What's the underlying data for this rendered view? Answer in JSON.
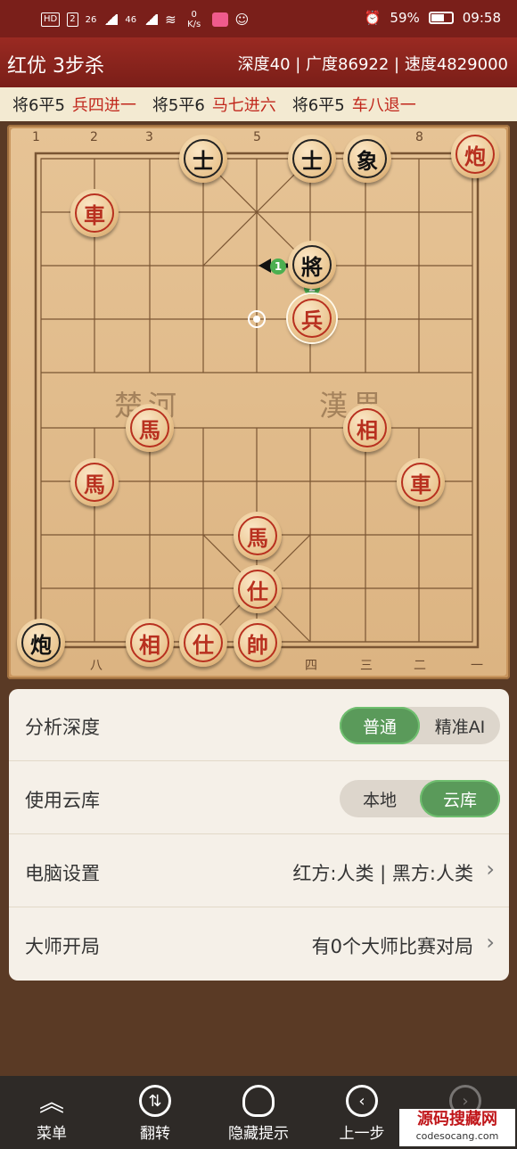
{
  "status": {
    "badges": [
      "HD",
      "2",
      "26",
      "46"
    ],
    "speed": "0 K/s",
    "battery": "59%",
    "time": "09:58"
  },
  "title": {
    "text": "红优 3步杀",
    "stats": "深度40 | 广度86922 | 速度4829000"
  },
  "moves": [
    {
      "black": "将6平5",
      "red": "兵四进一"
    },
    {
      "black": "将5平6",
      "red": "马七进六"
    },
    {
      "black": "将6平5",
      "red": "车八退一"
    }
  ],
  "board": {
    "top_files": [
      "1",
      "2",
      "3",
      "5",
      "8"
    ],
    "bottom_files": [
      "八",
      "四",
      "三",
      "二",
      "一"
    ],
    "river_left": "楚河",
    "river_right": "漢界",
    "markers": [
      "1",
      "2"
    ],
    "pieces": [
      {
        "ch": "士",
        "side": "black"
      },
      {
        "ch": "士",
        "side": "black"
      },
      {
        "ch": "象",
        "side": "black"
      },
      {
        "ch": "炮",
        "side": "red"
      },
      {
        "ch": "車",
        "side": "red"
      },
      {
        "ch": "將",
        "side": "black"
      },
      {
        "ch": "兵",
        "side": "red"
      },
      {
        "ch": "馬",
        "side": "red"
      },
      {
        "ch": "相",
        "side": "red"
      },
      {
        "ch": "馬",
        "side": "red"
      },
      {
        "ch": "車",
        "side": "red"
      },
      {
        "ch": "馬",
        "side": "red"
      },
      {
        "ch": "仕",
        "side": "red"
      },
      {
        "ch": "炮",
        "side": "black"
      },
      {
        "ch": "相",
        "side": "red"
      },
      {
        "ch": "仕",
        "side": "red"
      },
      {
        "ch": "帥",
        "side": "red"
      }
    ]
  },
  "settings": {
    "depth": {
      "label": "分析深度",
      "options": [
        "普通",
        "精准AI"
      ],
      "selected": "普通"
    },
    "cloud": {
      "label": "使用云库",
      "options": [
        "本地",
        "云库"
      ],
      "selected": "云库"
    },
    "computer": {
      "label": "电脑设置",
      "value": "红方:人类 | 黑方:人类"
    },
    "master": {
      "label": "大师开局",
      "value": "有0个大师比赛对局"
    }
  },
  "nav": [
    {
      "label": "菜单",
      "icon": "menu-icon"
    },
    {
      "label": "翻转",
      "icon": "flip-icon"
    },
    {
      "label": "隐藏提示",
      "icon": "bulb-icon"
    },
    {
      "label": "上一步",
      "icon": "back-icon"
    },
    {
      "label": "",
      "icon": "forward-icon"
    }
  ],
  "watermark": {
    "title": "源码搜藏网",
    "url": "codesocang.com"
  }
}
